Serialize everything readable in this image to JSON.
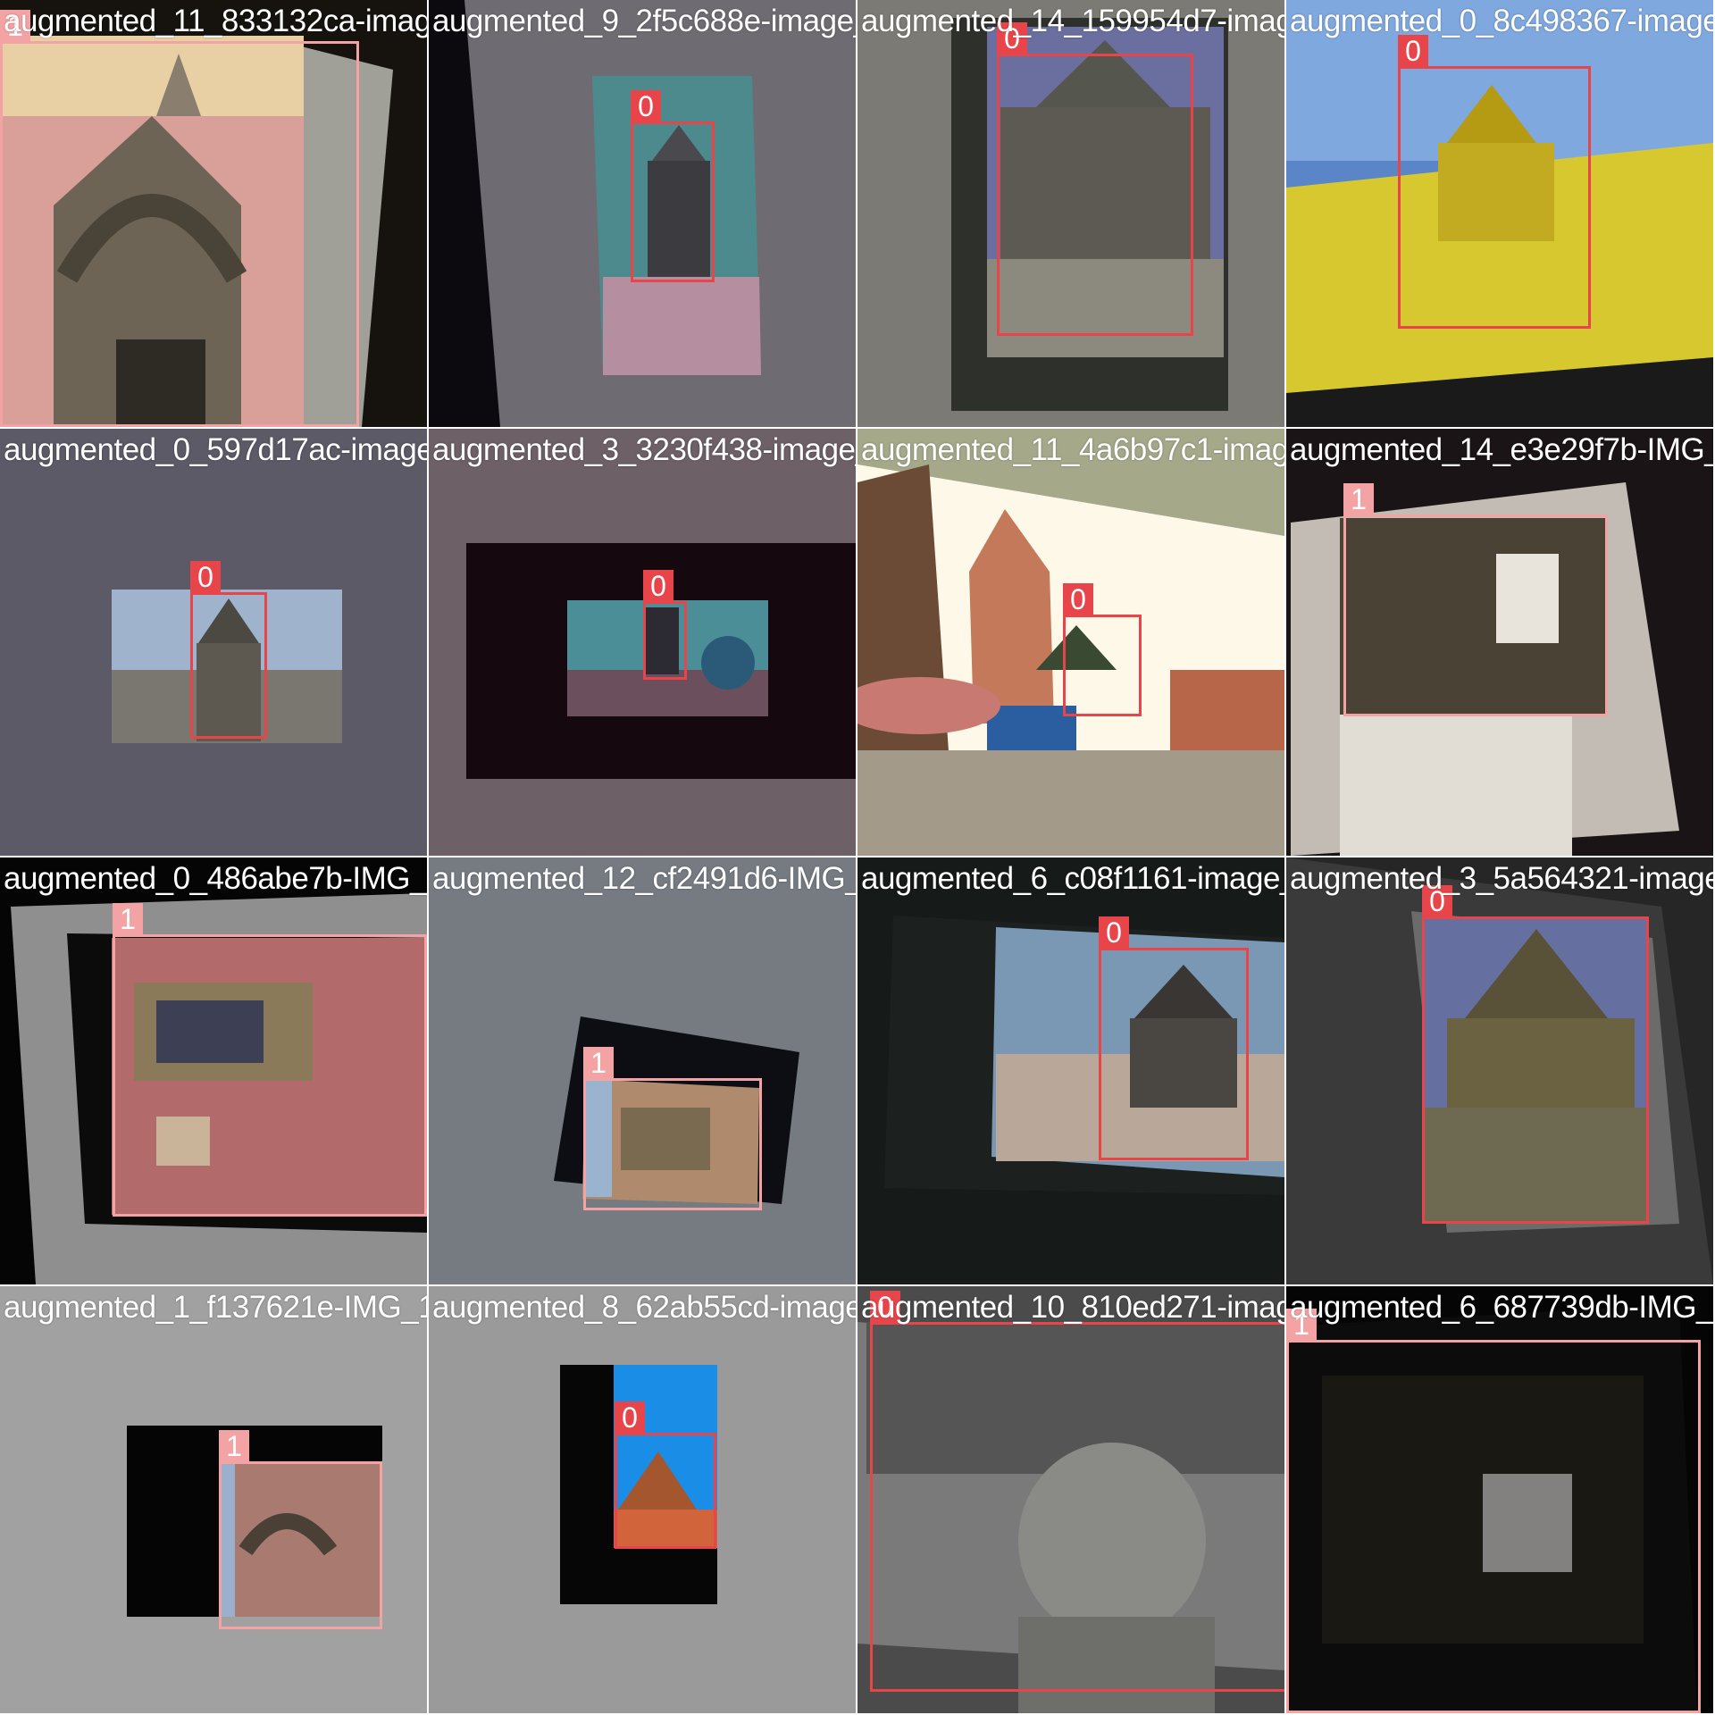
{
  "mosaic": {
    "class_colors": {
      "0": "#e8454a",
      "1": "#f4a3a5"
    },
    "tiles": [
      {
        "filename": "augmented_11_833132ca-image_264.png",
        "boxes": [
          {
            "label": "1"
          }
        ]
      },
      {
        "filename": "augmented_9_2f5c688e-image_116.png",
        "boxes": [
          {
            "label": "0"
          }
        ]
      },
      {
        "filename": "augmented_14_159954d7-image_192.png",
        "boxes": [
          {
            "label": "0"
          }
        ]
      },
      {
        "filename": "augmented_0_8c498367-image.png",
        "boxes": [
          {
            "label": "0"
          }
        ]
      },
      {
        "filename": "augmented_0_597d17ac-image_72.png",
        "boxes": [
          {
            "label": "0"
          }
        ]
      },
      {
        "filename": "augmented_3_3230f438-image_337.png",
        "boxes": [
          {
            "label": "0"
          }
        ]
      },
      {
        "filename": "augmented_11_4a6b97c1-image_77.png",
        "boxes": [
          {
            "label": "0"
          }
        ]
      },
      {
        "filename": "augmented_14_e3e29f7b-IMG_1871.JPG",
        "boxes": [
          {
            "label": "1"
          }
        ]
      },
      {
        "filename": "augmented_0_486abe7b-IMG_1871.JPG",
        "boxes": [
          {
            "label": "1"
          }
        ]
      },
      {
        "filename": "augmented_12_cf2491d6-IMG_1903.JPG",
        "boxes": [
          {
            "label": "1"
          }
        ]
      },
      {
        "filename": "augmented_6_c08f1161-image_30.png",
        "boxes": [
          {
            "label": "0"
          }
        ]
      },
      {
        "filename": "augmented_3_5a564321-image.png",
        "boxes": [
          {
            "label": "0"
          }
        ]
      },
      {
        "filename": "augmented_1_f137621e-IMG_1902.JPG",
        "boxes": [
          {
            "label": "1"
          }
        ]
      },
      {
        "filename": "augmented_8_62ab55cd-image_175.png",
        "boxes": [
          {
            "label": "0"
          }
        ]
      },
      {
        "filename": "augmented_10_810ed271-image_494.png",
        "boxes": [
          {
            "label": "0"
          }
        ]
      },
      {
        "filename": "augmented_6_687739db-IMG_1903.JPG",
        "boxes": [
          {
            "label": "1"
          }
        ]
      }
    ]
  }
}
